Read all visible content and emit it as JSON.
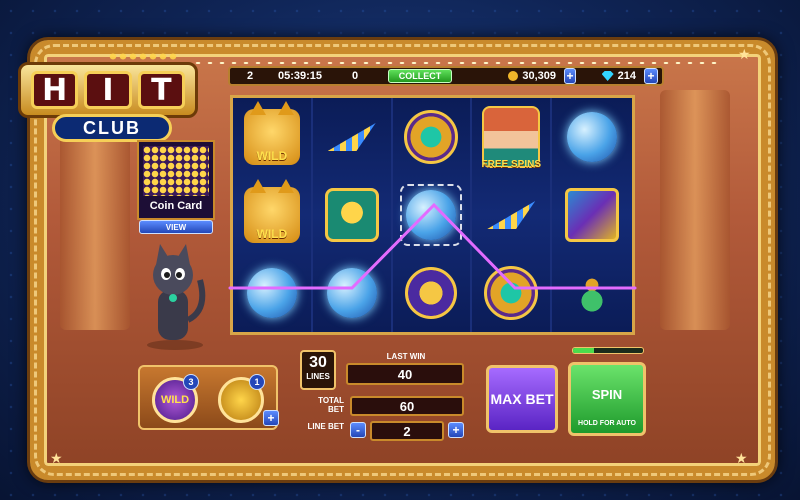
{
  "logo": {
    "letters": [
      "H",
      "I",
      "T"
    ],
    "sub": "CLUB"
  },
  "topbar": {
    "level": "2",
    "timer": "05:39:15",
    "coins_small": "0",
    "collect_label": "COLLECT",
    "balance": "30,309",
    "gems": "214",
    "plus_label": "+"
  },
  "coin_card": {
    "label": "Coin Card",
    "view_label": "VIEW"
  },
  "reels": [
    [
      "cat-wild",
      "cat-wild",
      "yarn-ball"
    ],
    [
      "paper-plane",
      "mouse-tile",
      "yarn-ball"
    ],
    [
      "scarab",
      "yarn-ball",
      "ankh-orb"
    ],
    [
      "free-spins-girl",
      "paper-plane",
      "scarab"
    ],
    [
      "yarn-ball",
      "lizard-tile",
      "lotus"
    ]
  ],
  "symbol_text": {
    "wild": "WILD",
    "free_spins": "FREE SPINS"
  },
  "boosters": {
    "wild_label": "WILD",
    "wild_count": "3",
    "coin_count": "1",
    "plus_label": "+"
  },
  "bet": {
    "lines_value": "30",
    "lines_label": "LINES",
    "last_win_label": "LAST WIN",
    "last_win_value": "40",
    "total_bet_label": "TOTAL BET",
    "total_bet_value": "60",
    "line_bet_label": "LINE BET",
    "line_bet_value": "2",
    "minus_label": "-",
    "plus_label": "+"
  },
  "max_bet_label": "MAX BET",
  "spin": {
    "label": "SPIN",
    "sub": "HOLD FOR AUTO",
    "progress": 0.3
  },
  "colors": {
    "accent_gold": "#f0c36a",
    "spin_green": "#1e9a2c",
    "maxbet_purple": "#5a24c4",
    "payline": "#e36bff"
  }
}
